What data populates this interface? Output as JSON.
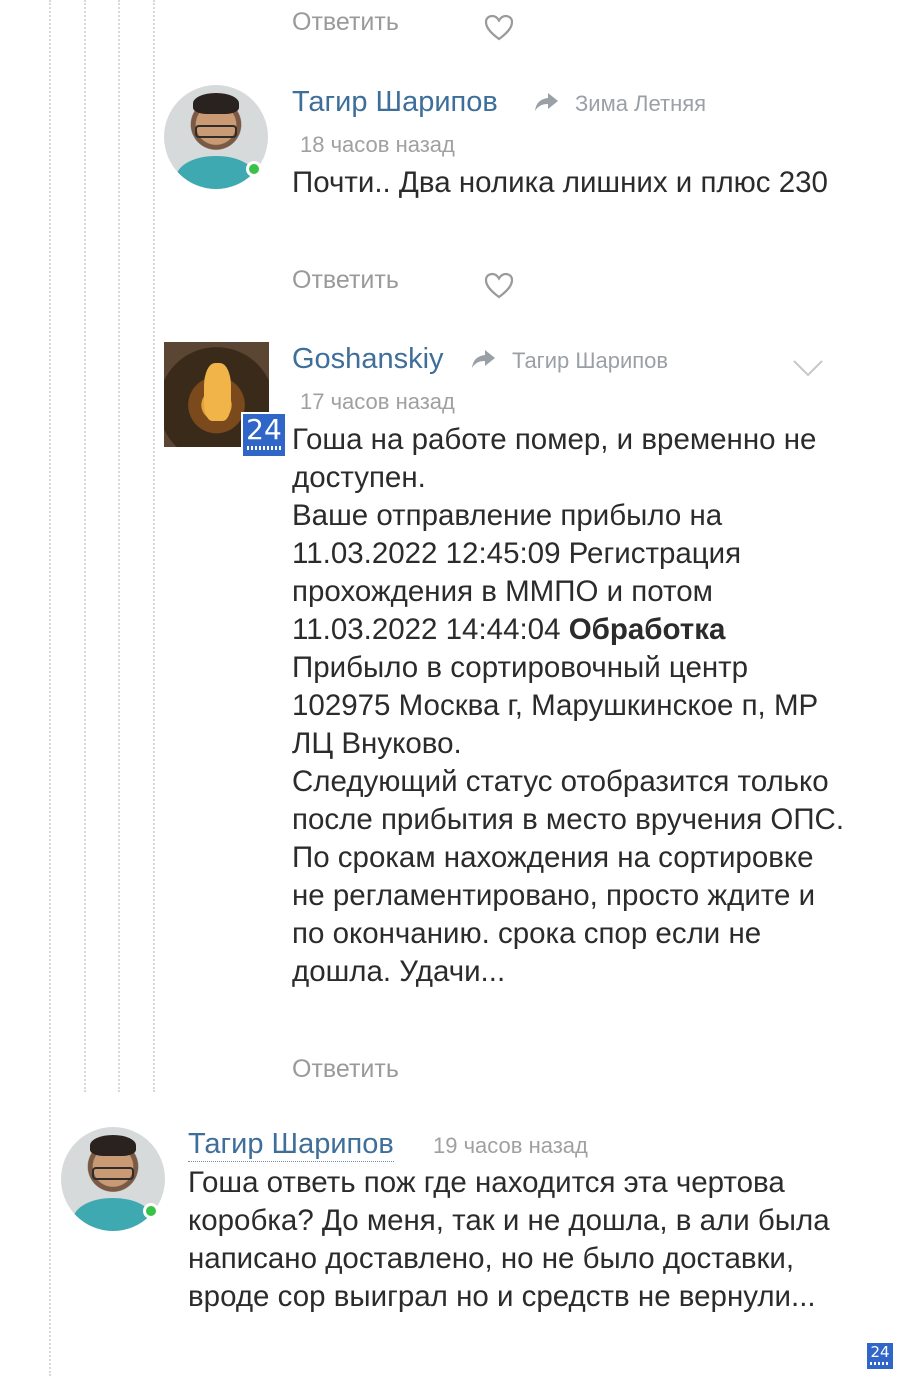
{
  "reply_label": "Ответить",
  "comments": [
    {
      "author": "Тагир Шарипов",
      "reply_to": "Зима Летняя",
      "time": "18 часов назад",
      "text": "Почти.. Два нолика лишних и плюс 230"
    },
    {
      "author": "Goshanskiy",
      "reply_to": "Тагир Шарипов",
      "time": "17 часов назад",
      "badge": "24",
      "paragraph1": "Гоша на работе помер, и временно не доступен.",
      "paragraph2_before": "Ваше отправление прибыло на 11.03.2022 12:45:09 Регистрация прохождения в ММПО и потом 11.03.2022 14:44:04 ",
      "paragraph2_bold": "Обработка",
      "paragraph2_after": " Прибыло в сортировочный центр 102975 Москва г, Марушкинское п, МР ЛЦ Внуково.",
      "paragraph3": "Следующий статус отобразится только после прибытия в место вручения ОПС. По срокам нахождения на сортировке не регламентировано, просто ждите и по окончанию. срока спор если не дошла. Удачи..."
    },
    {
      "author": "Тагир Шарипов",
      "time": "19 часов назад",
      "text": "Гоша ответь пож где находится эта чертова коробка? До меня, так и не дошла, в али была написано доставлено, но не было доставки, вроде сор выиграл но и средств не вернули..."
    }
  ],
  "corner_badge": "24",
  "colors": {
    "author": "#3e6e9a",
    "badge": "#2f66c8",
    "online": "#38c248"
  }
}
